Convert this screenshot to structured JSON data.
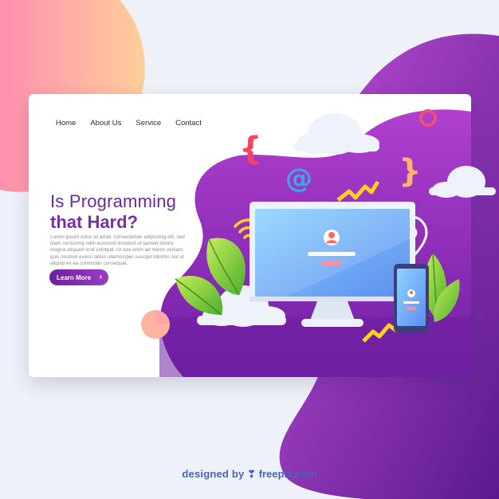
{
  "nav": {
    "items": [
      {
        "label": "Home"
      },
      {
        "label": "About Us"
      },
      {
        "label": "Service"
      },
      {
        "label": "Contact"
      }
    ]
  },
  "hero": {
    "title_line1": "Is Programming",
    "title_line2": "that Hard?",
    "body": "Lorem ipsum dolor sit amet, consectetuer adipiscing elit, sed diam nonummy nibh euismod tincidunt ut laoreet dolore magna aliquam erat volutpat. Ut wisi enim ad minim veniam, quis nostrud exerci tation ullamcorper suscipit lobortis nisl ut aliquip ex ea commodo consequat.",
    "button_label": "Learn More"
  },
  "credit": {
    "prefix": "designed by",
    "brand": "freepik.com"
  },
  "colors": {
    "purple_dark": "#6b1f9e",
    "purple_light": "#b24fd0",
    "yellow": "#ffd21f",
    "green": "#8bd13d",
    "blue": "#4a63b8"
  },
  "icons": [
    "curly-brace-icon",
    "at-sign-icon",
    "wifi-icon",
    "location-pin-icon",
    "user-avatar-icon",
    "ring-icon",
    "cloud-icon",
    "leaf-icon",
    "monitor-icon",
    "phone-icon"
  ]
}
